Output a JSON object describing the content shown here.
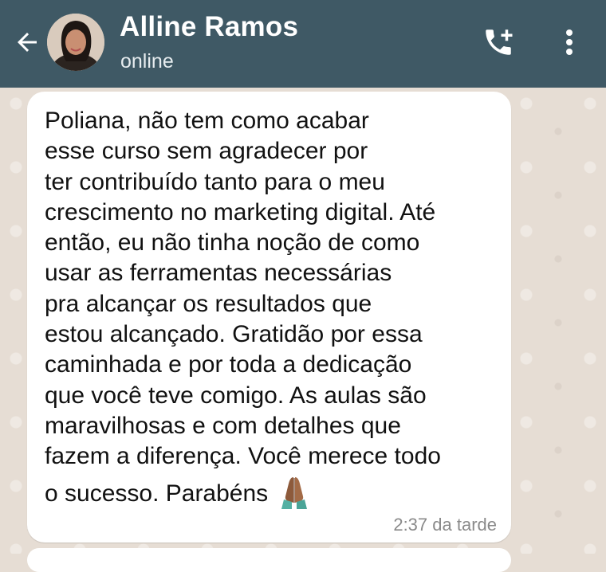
{
  "header": {
    "contact_name": "Alline Ramos",
    "status": "online",
    "back_icon": "arrow-left-icon",
    "call_icon": "add-call-icon",
    "menu_icon": "more-vertical-icon",
    "background": "#3f5965"
  },
  "message": {
    "lines": [
      "Poliana, não tem como acabar",
      "esse curso sem agradecer por",
      "ter contribuído tanto para o meu",
      "crescimento no marketing digital. Até",
      "então, eu não tinha noção de como",
      "usar as ferramentas necessárias",
      "pra alcançar os resultados que",
      "estou alcançado. Gratidão por essa",
      "caminhada e por toda a dedicação",
      "que você teve comigo. As aulas são",
      "maravilhosas e com detalhes que",
      "fazem a diferença. Você merece todo",
      "o sucesso. Parabéns"
    ],
    "emoji": "folded-hands-icon",
    "time": "2:37 da tarde"
  },
  "colors": {
    "chat_background": "#e6ddd4",
    "bubble": "#ffffff",
    "timestamp": "#8a8a8a"
  }
}
